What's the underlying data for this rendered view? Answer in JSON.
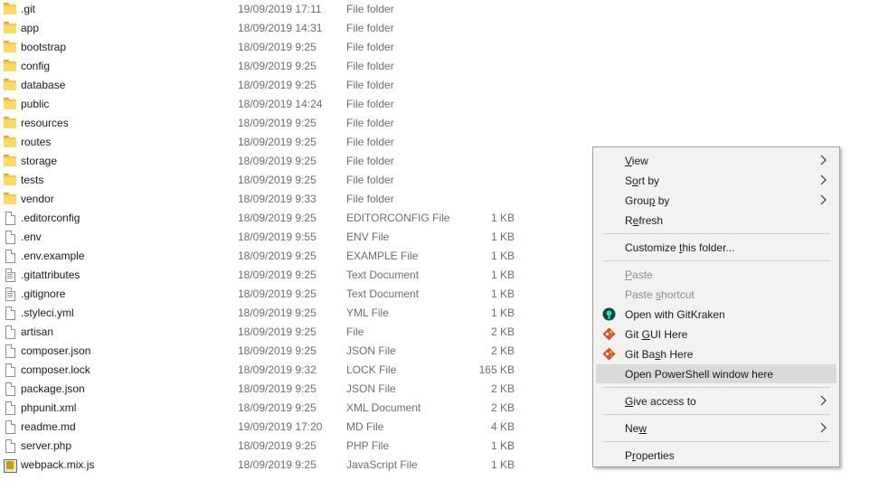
{
  "files": [
    {
      "name": ".git",
      "date": "19/09/2019 17:11",
      "type": "File folder",
      "size": "",
      "icon": "folder-icon"
    },
    {
      "name": "app",
      "date": "18/09/2019 14:31",
      "type": "File folder",
      "size": "",
      "icon": "folder-icon"
    },
    {
      "name": "bootstrap",
      "date": "18/09/2019 9:25",
      "type": "File folder",
      "size": "",
      "icon": "folder-icon"
    },
    {
      "name": "config",
      "date": "18/09/2019 9:25",
      "type": "File folder",
      "size": "",
      "icon": "folder-icon"
    },
    {
      "name": "database",
      "date": "18/09/2019 9:25",
      "type": "File folder",
      "size": "",
      "icon": "folder-icon"
    },
    {
      "name": "public",
      "date": "18/09/2019 14:24",
      "type": "File folder",
      "size": "",
      "icon": "folder-icon"
    },
    {
      "name": "resources",
      "date": "18/09/2019 9:25",
      "type": "File folder",
      "size": "",
      "icon": "folder-icon"
    },
    {
      "name": "routes",
      "date": "18/09/2019 9:25",
      "type": "File folder",
      "size": "",
      "icon": "folder-icon"
    },
    {
      "name": "storage",
      "date": "18/09/2019 9:25",
      "type": "File folder",
      "size": "",
      "icon": "folder-icon"
    },
    {
      "name": "tests",
      "date": "18/09/2019 9:25",
      "type": "File folder",
      "size": "",
      "icon": "folder-icon"
    },
    {
      "name": "vendor",
      "date": "18/09/2019 9:33",
      "type": "File folder",
      "size": "",
      "icon": "folder-icon"
    },
    {
      "name": ".editorconfig",
      "date": "18/09/2019 9:25",
      "type": "EDITORCONFIG File",
      "size": "1 KB",
      "icon": "file-icon"
    },
    {
      "name": ".env",
      "date": "18/09/2019 9:55",
      "type": "ENV File",
      "size": "1 KB",
      "icon": "file-icon"
    },
    {
      "name": ".env.example",
      "date": "18/09/2019 9:25",
      "type": "EXAMPLE File",
      "size": "1 KB",
      "icon": "file-icon"
    },
    {
      "name": ".gitattributes",
      "date": "18/09/2019 9:25",
      "type": "Text Document",
      "size": "1 KB",
      "icon": "text-file-icon"
    },
    {
      "name": ".gitignore",
      "date": "18/09/2019 9:25",
      "type": "Text Document",
      "size": "1 KB",
      "icon": "text-file-icon"
    },
    {
      "name": ".styleci.yml",
      "date": "18/09/2019 9:25",
      "type": "YML File",
      "size": "1 KB",
      "icon": "file-icon"
    },
    {
      "name": "artisan",
      "date": "18/09/2019 9:25",
      "type": "File",
      "size": "2 KB",
      "icon": "file-icon"
    },
    {
      "name": "composer.json",
      "date": "18/09/2019 9:25",
      "type": "JSON File",
      "size": "2 KB",
      "icon": "file-icon"
    },
    {
      "name": "composer.lock",
      "date": "18/09/2019 9:32",
      "type": "LOCK File",
      "size": "165 KB",
      "icon": "file-icon"
    },
    {
      "name": "package.json",
      "date": "18/09/2019 9:25",
      "type": "JSON File",
      "size": "2 KB",
      "icon": "file-icon"
    },
    {
      "name": "phpunit.xml",
      "date": "18/09/2019 9:25",
      "type": "XML Document",
      "size": "2 KB",
      "icon": "file-icon"
    },
    {
      "name": "readme.md",
      "date": "19/09/2019 17:20",
      "type": "MD File",
      "size": "4 KB",
      "icon": "file-icon"
    },
    {
      "name": "server.php",
      "date": "18/09/2019 9:25",
      "type": "PHP File",
      "size": "1 KB",
      "icon": "file-icon"
    },
    {
      "name": "webpack.mix.js",
      "date": "18/09/2019 9:25",
      "type": "JavaScript File",
      "size": "1 KB",
      "icon": "js-file-icon"
    }
  ],
  "context_menu": {
    "items": [
      {
        "kind": "item",
        "pre": "",
        "key": "V",
        "post": "iew",
        "submenu": true,
        "name": "menu-item-view"
      },
      {
        "kind": "item",
        "pre": "S",
        "key": "o",
        "post": "rt by",
        "submenu": true,
        "name": "menu-item-sort-by"
      },
      {
        "kind": "item",
        "pre": "Grou",
        "key": "p",
        "post": " by",
        "submenu": true,
        "name": "menu-item-group-by"
      },
      {
        "kind": "item",
        "pre": "R",
        "key": "e",
        "post": "fresh",
        "name": "menu-item-refresh"
      },
      {
        "kind": "sep"
      },
      {
        "kind": "item",
        "pre": "Customize ",
        "key": "t",
        "post": "his folder...",
        "name": "menu-item-customize-folder"
      },
      {
        "kind": "sep"
      },
      {
        "kind": "item",
        "pre": "",
        "key": "P",
        "post": "aste",
        "disabled": true,
        "name": "menu-item-paste"
      },
      {
        "kind": "item",
        "pre": "Paste ",
        "key": "s",
        "post": "hortcut",
        "disabled": true,
        "name": "menu-item-paste-shortcut"
      },
      {
        "kind": "item",
        "pre": "Open with GitKraken",
        "key": "",
        "post": "",
        "icon": "gitkraken-icon",
        "name": "menu-item-open-gitkraken"
      },
      {
        "kind": "item",
        "pre": "Git ",
        "key": "G",
        "post": "UI Here",
        "icon": "git-icon",
        "name": "menu-item-git-gui"
      },
      {
        "kind": "item",
        "pre": "Git Ba",
        "key": "s",
        "post": "h Here",
        "icon": "git-icon",
        "name": "menu-item-git-bash"
      },
      {
        "kind": "item",
        "pre": "Open PowerShell window here",
        "key": "",
        "post": "",
        "hover": true,
        "name": "menu-item-open-powershell"
      },
      {
        "kind": "sep"
      },
      {
        "kind": "item",
        "pre": "",
        "key": "G",
        "post": "ive access to",
        "submenu": true,
        "name": "menu-item-give-access"
      },
      {
        "kind": "sep"
      },
      {
        "kind": "item",
        "pre": "Ne",
        "key": "w",
        "post": "",
        "submenu": true,
        "name": "menu-item-new"
      },
      {
        "kind": "sep"
      },
      {
        "kind": "item",
        "pre": "P",
        "key": "r",
        "post": "operties",
        "name": "menu-item-properties"
      }
    ]
  },
  "colors": {
    "menu_bg": "#f2f2f2",
    "menu_hover": "#dadada",
    "folder": "#f4c74c",
    "secondary_text": "#6d6d6d",
    "disabled_text": "#8d8d8d"
  }
}
